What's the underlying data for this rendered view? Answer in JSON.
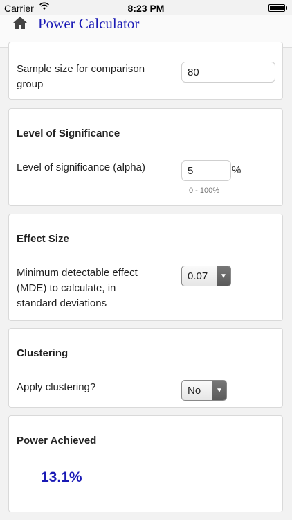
{
  "status_bar": {
    "carrier": "Carrier",
    "time": "8:23 PM"
  },
  "header": {
    "title": "Power Calculator",
    "home_icon": "home-icon"
  },
  "sample_size": {
    "label": "Sample size for comparison group",
    "value": "80"
  },
  "significance": {
    "title": "Level of Significance",
    "label": "Level of significance (alpha)",
    "value": "5",
    "unit": "%",
    "hint": "0 - 100%"
  },
  "effect_size": {
    "title": "Effect Size",
    "label_lines": [
      "Minimum detectable effect",
      "(MDE) to calculate, in",
      "standard deviations"
    ],
    "selected": "0.07"
  },
  "clustering": {
    "title": "Clustering",
    "label": "Apply clustering?",
    "selected": "No"
  },
  "power": {
    "title": "Power Achieved",
    "value": "13.1%"
  },
  "colors": {
    "accent": "#1a1ab5",
    "background": "#f2f2f2"
  }
}
